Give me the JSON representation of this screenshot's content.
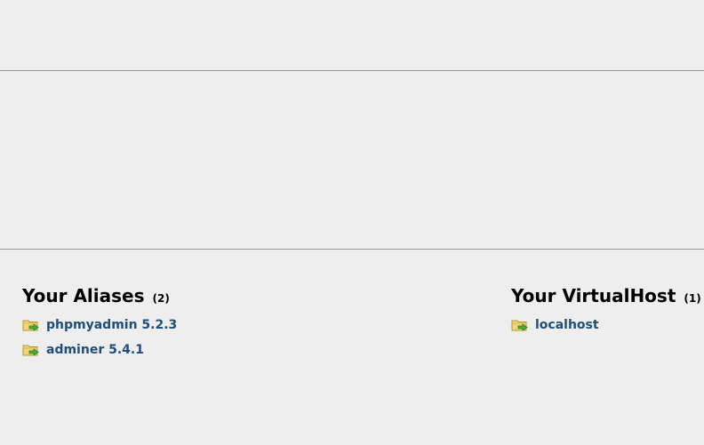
{
  "aliases": {
    "title": "Your Aliases",
    "count": "(2)",
    "items": [
      {
        "label": "phpmyadmin 5.2.3",
        "icon": "folder-arrow-icon"
      },
      {
        "label": "adminer 5.4.1",
        "icon": "folder-arrow-icon"
      }
    ]
  },
  "virtualhosts": {
    "title": "Your VirtualHost",
    "count": "(1)",
    "items": [
      {
        "label": "localhost",
        "icon": "folder-arrow-icon"
      }
    ]
  },
  "colors": {
    "background": "#eeeeee",
    "link": "#1f4e79",
    "rule": "#999999",
    "folder": "#f0d57a",
    "arrow": "#4caf30"
  }
}
